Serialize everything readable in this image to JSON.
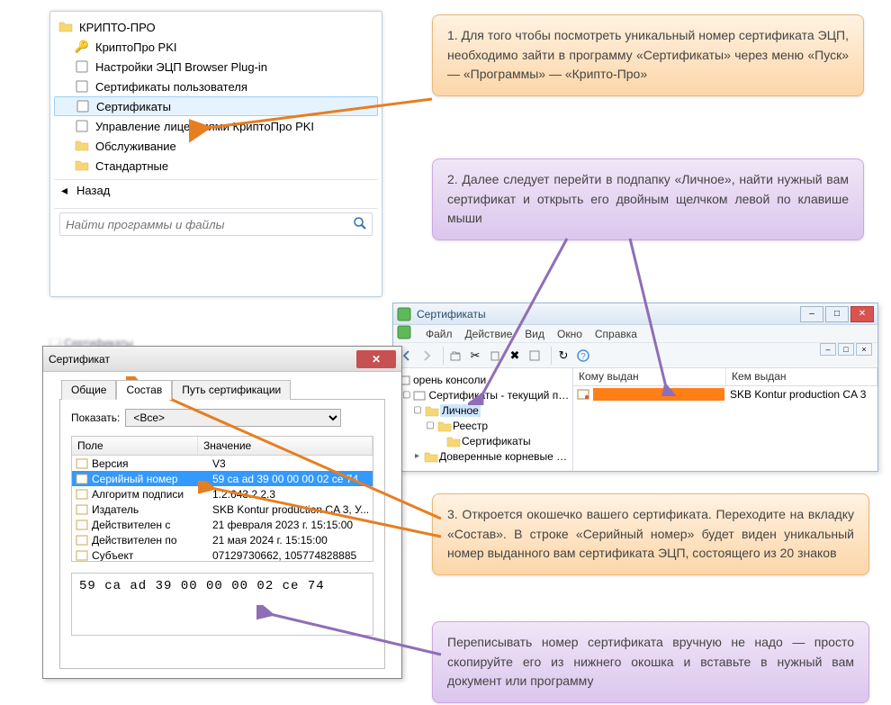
{
  "start_menu": {
    "root": "КРИПТО-ПРО",
    "items": [
      "КриптоПро PKI",
      "Настройки ЭЦП Browser Plug-in",
      "Сертификаты пользователя",
      "Сертификаты",
      "Управление лицензиями КриптоПро PKI",
      "Обслуживание",
      "Стандартные"
    ],
    "back": "Назад",
    "search_placeholder": "Найти программы и файлы"
  },
  "mmc": {
    "title": "Сертификаты",
    "menu": [
      "Файл",
      "Действие",
      "Вид",
      "Окно",
      "Справка"
    ],
    "tree": {
      "root": "орень консоли",
      "l1": "Сертификаты - текущий пользов",
      "personal": "Личное",
      "registry": "Реестр",
      "certs": "Сертификаты",
      "trusted": "Доверенные корневые центр"
    },
    "columns": {
      "issued_to": "Кому выдан",
      "issued_by": "Кем выдан"
    },
    "row_issuer": "SKB Kontur production CA 3"
  },
  "cert_dialog": {
    "title": "Сертификат",
    "tabs": [
      "Общие",
      "Состав",
      "Путь сертификации"
    ],
    "show_label": "Показать:",
    "show_value": "<Все>",
    "columns": {
      "field": "Поле",
      "value": "Значение"
    },
    "rows": [
      {
        "field": "Версия",
        "value": "V3"
      },
      {
        "field": "Серийный номер",
        "value": "59 ca ad 39 00 00 00 02 ce 74"
      },
      {
        "field": "Алгоритм подписи",
        "value": "1.2.643.2.2.3"
      },
      {
        "field": "Издатель",
        "value": "SKB Kontur production CA 3, У..."
      },
      {
        "field": "Действителен с",
        "value": "21 февраля 2023 г. 15:15:00"
      },
      {
        "field": "Действителен по",
        "value": "21 мая 2024 г. 15:15:00"
      },
      {
        "field": "Субъект",
        "value": "07129730662, 105774828885"
      }
    ],
    "detail": "59 ca ad 39 00 00 00 02 ce 74"
  },
  "callouts": {
    "c1": "1. Для того чтобы посмотреть уникальный номер сертификата ЭЦП, необходимо зайти в программу «Сертификаты» через меню «Пуск» — «Программы» — «Крипто-Про»",
    "c2": "2. Далее следует перейти в подпапку «Личное», найти нужный вам сертификат и открыть его двойным щелчком левой по клавише мыши",
    "c3": "3. Откроется окошечко вашего сертификата. Переходите на вкладку «Состав». В строке «Серийный номер» будет виден уникальный номер выданного вам сертификата ЭЦП, состоящего из 20 знаков",
    "c4": "Переписывать номер сертификата вручную не надо — просто скопируйте его из нижнего окошка и вставьте в нужный вам документ или программу"
  }
}
